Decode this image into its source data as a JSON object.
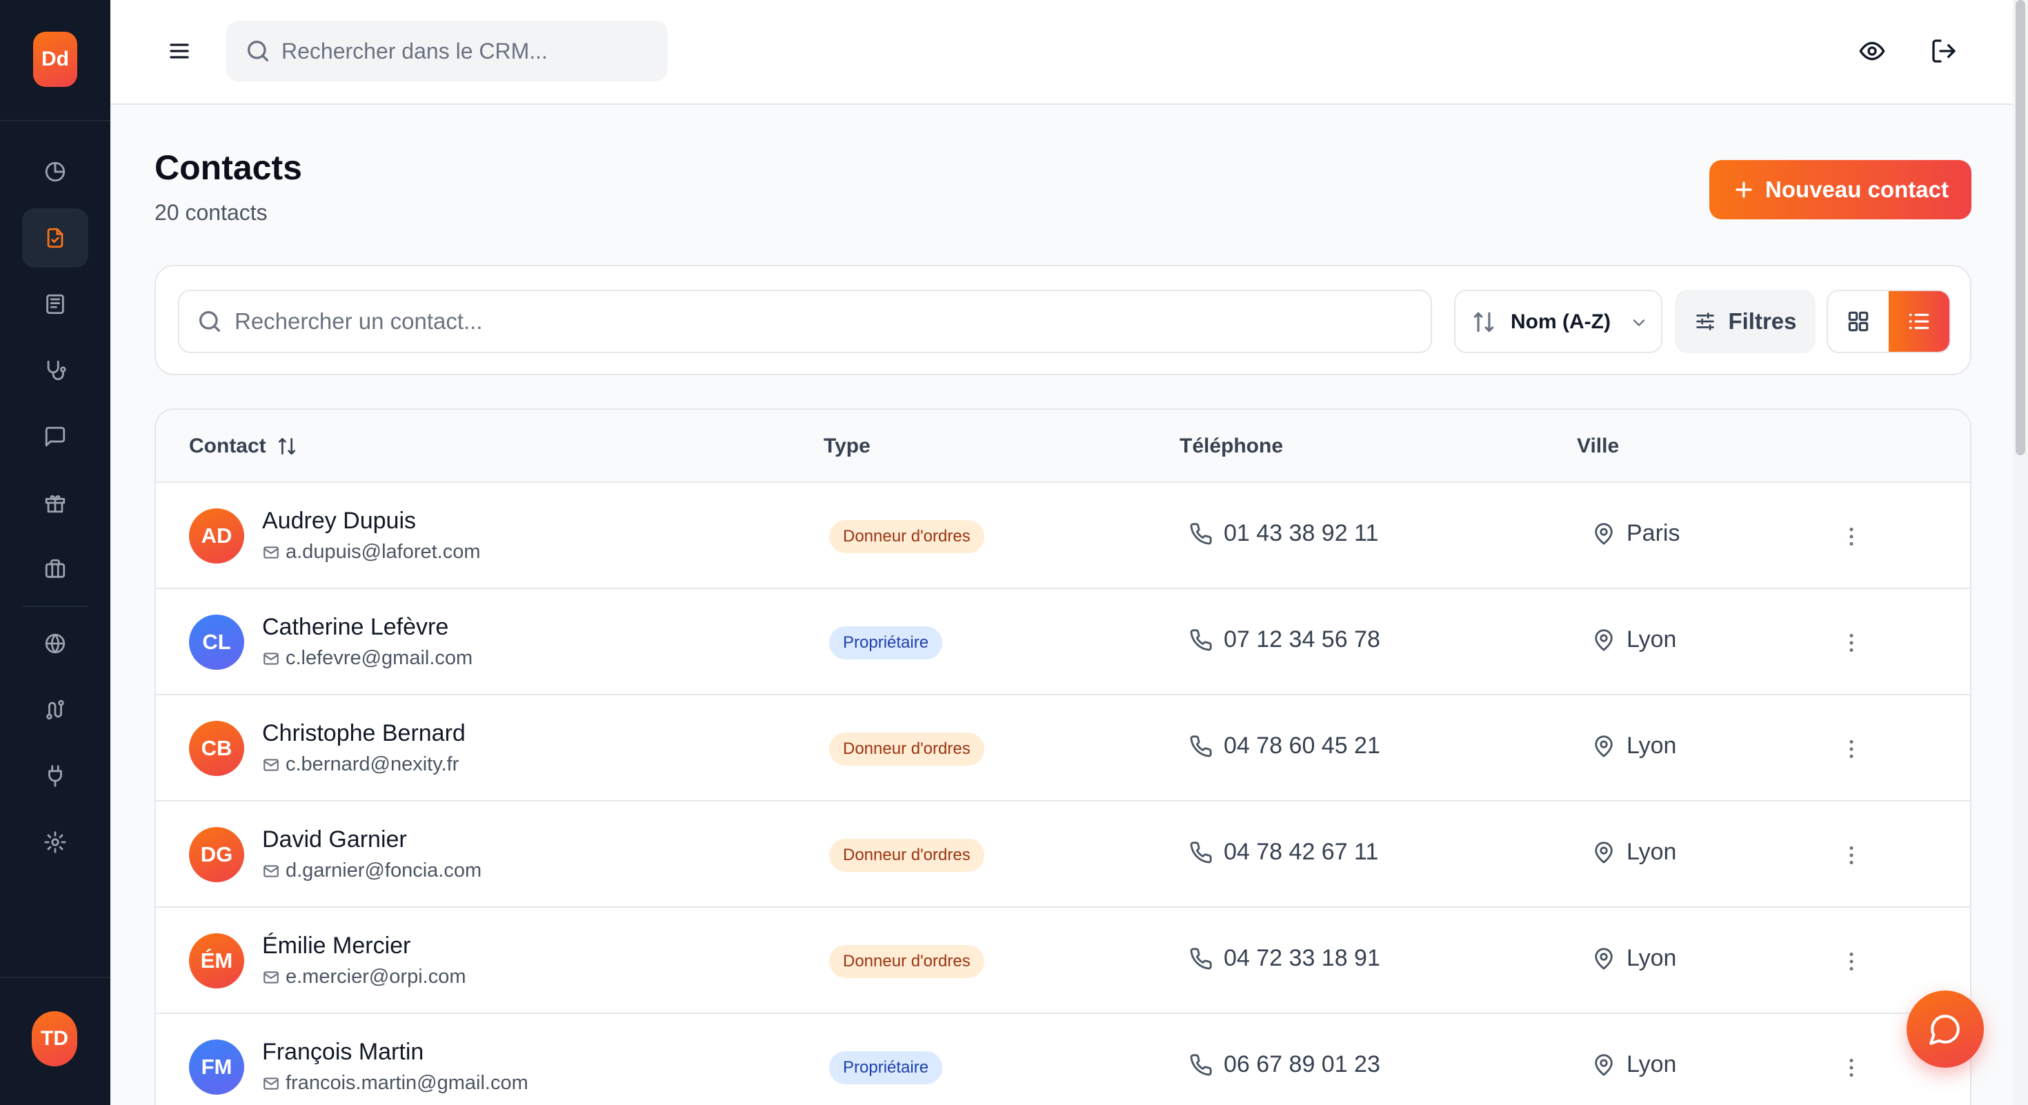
{
  "sidebar": {
    "logo_text": "Dd",
    "user_initials": "TD",
    "nav": [
      {
        "name": "dashboard",
        "icon": "chart-pie-icon"
      },
      {
        "name": "contacts",
        "icon": "clipboard-check-icon",
        "active": true
      },
      {
        "name": "news",
        "icon": "newspaper-icon"
      },
      {
        "name": "interventions",
        "icon": "stethoscope-icon"
      },
      {
        "name": "messages",
        "icon": "message-icon"
      },
      {
        "name": "rewards",
        "icon": "gift-icon"
      },
      {
        "name": "briefcase",
        "icon": "briefcase-icon"
      },
      {
        "name": "web",
        "icon": "globe-icon"
      },
      {
        "name": "workflows",
        "icon": "route-icon"
      },
      {
        "name": "integrations",
        "icon": "plug-icon"
      },
      {
        "name": "settings",
        "icon": "gear-icon"
      }
    ]
  },
  "topbar": {
    "search_placeholder": "Rechercher dans le CRM...",
    "icons": [
      "menu-icon",
      "search-icon",
      "eye-icon",
      "logout-icon"
    ]
  },
  "page": {
    "title": "Contacts",
    "subtitle": "20 contacts",
    "new_button_label": "Nouveau contact"
  },
  "toolbar": {
    "search_placeholder": "Rechercher un contact...",
    "sort_label": "Nom (A-Z)",
    "filters_label": "Filtres",
    "view_mode": "list"
  },
  "table": {
    "headers": {
      "contact": "Contact",
      "type": "Type",
      "phone": "Téléphone",
      "city": "Ville"
    },
    "rows": [
      {
        "initials": "AD",
        "name": "Audrey Dupuis",
        "email": "a.dupuis@laforet.com",
        "type": "Donneur d'ordres",
        "type_kind": "do",
        "phone": "01 43 38 92 11",
        "city": "Paris",
        "avatar_color": "orange"
      },
      {
        "initials": "CL",
        "name": "Catherine Lefèvre",
        "email": "c.lefevre@gmail.com",
        "type": "Propriétaire",
        "type_kind": "pr",
        "phone": "07 12 34 56 78",
        "city": "Lyon",
        "avatar_color": "blue"
      },
      {
        "initials": "CB",
        "name": "Christophe Bernard",
        "email": "c.bernard@nexity.fr",
        "type": "Donneur d'ordres",
        "type_kind": "do",
        "phone": "04 78 60 45 21",
        "city": "Lyon",
        "avatar_color": "orange"
      },
      {
        "initials": "DG",
        "name": "David Garnier",
        "email": "d.garnier@foncia.com",
        "type": "Donneur d'ordres",
        "type_kind": "do",
        "phone": "04 78 42 67 11",
        "city": "Lyon",
        "avatar_color": "orange"
      },
      {
        "initials": "ÉM",
        "name": "Émilie Mercier",
        "email": "e.mercier@orpi.com",
        "type": "Donneur d'ordres",
        "type_kind": "do",
        "phone": "04 72 33 18 91",
        "city": "Lyon",
        "avatar_color": "orange"
      },
      {
        "initials": "FM",
        "name": "François Martin",
        "email": "francois.martin@gmail.com",
        "type": "Propriétaire",
        "type_kind": "pr",
        "phone": "06 67 89 01 23",
        "city": "Lyon",
        "avatar_color": "blue"
      }
    ]
  },
  "colors": {
    "accent_start": "#f97316",
    "accent_end": "#ef4444",
    "sidebar_bg": "#111827",
    "badge_do_bg": "#ffedd5",
    "badge_pr_bg": "#dbeafe"
  }
}
